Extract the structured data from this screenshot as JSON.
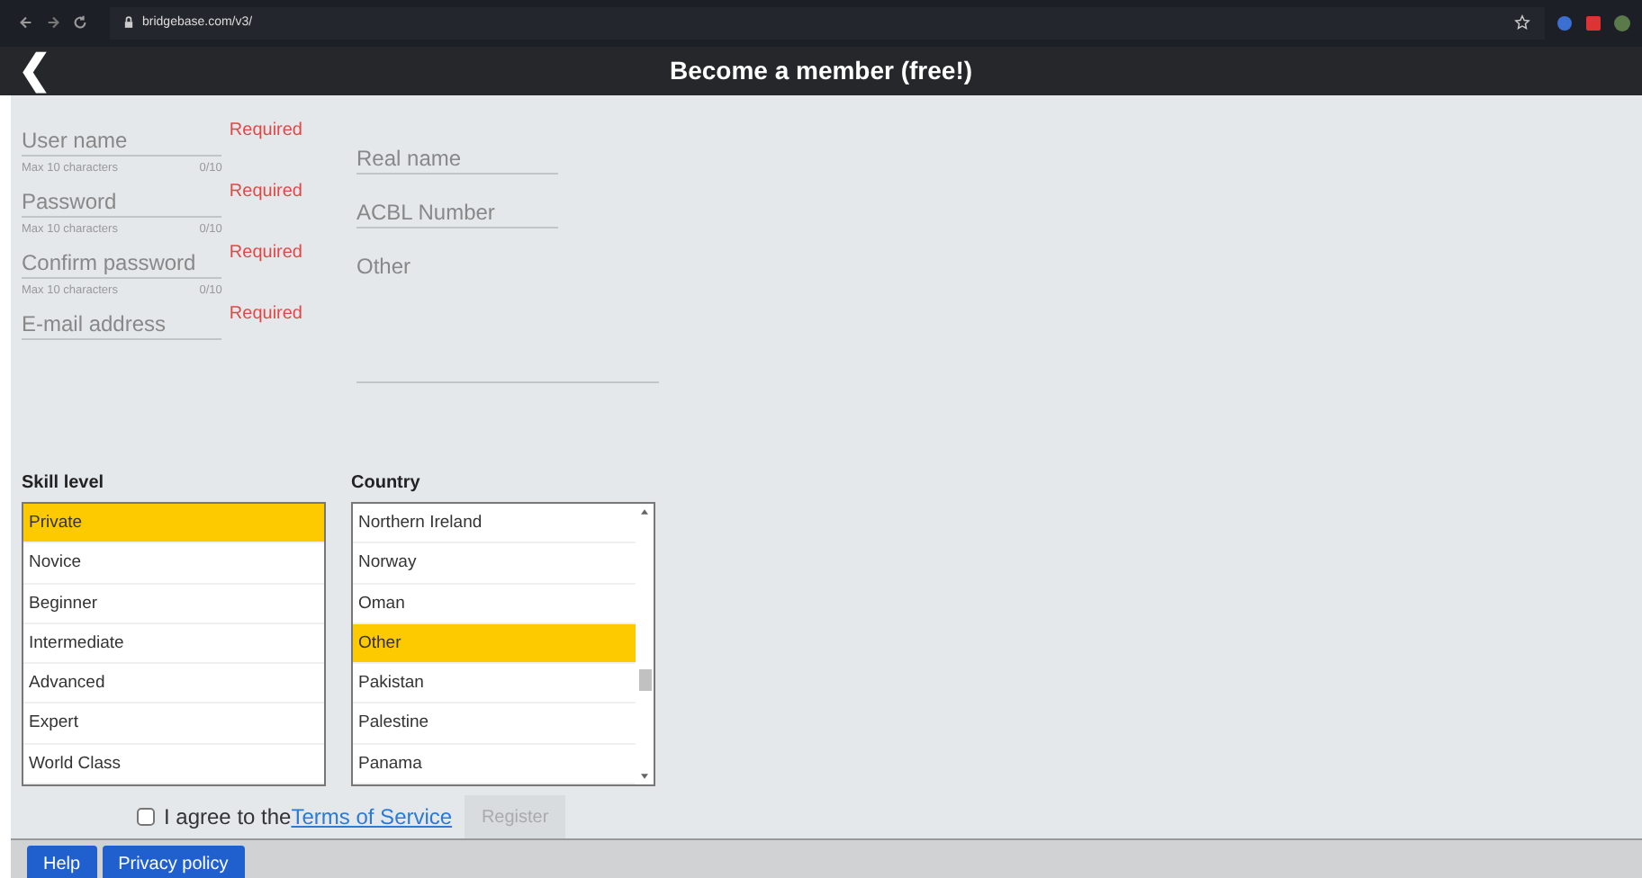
{
  "browser": {
    "url": "bridgebase.com/v3/"
  },
  "header": {
    "back": "❮",
    "title": "Become a member (free!)"
  },
  "account_fields": [
    {
      "placeholder": "User name",
      "required": "Required",
      "hint": "Max 10 characters",
      "counter": "0/10"
    },
    {
      "placeholder": "Password",
      "required": "Required",
      "hint": "Max 10 characters",
      "counter": "0/10"
    },
    {
      "placeholder": "Confirm password",
      "required": "Required",
      "hint": "Max 10 characters",
      "counter": "0/10"
    },
    {
      "placeholder": "E-mail address",
      "required": "Required"
    }
  ],
  "profile_fields": [
    {
      "placeholder": "Real name"
    },
    {
      "placeholder": "ACBL Number"
    }
  ],
  "other_field": {
    "placeholder": "Other"
  },
  "skill_level": {
    "label": "Skill level",
    "items": [
      {
        "label": "Private",
        "selected": true
      },
      {
        "label": "Novice",
        "selected": false
      },
      {
        "label": "Beginner",
        "selected": false
      },
      {
        "label": "Intermediate",
        "selected": false
      },
      {
        "label": "Advanced",
        "selected": false
      },
      {
        "label": "Expert",
        "selected": false
      },
      {
        "label": "World Class",
        "selected": false
      }
    ]
  },
  "country": {
    "label": "Country",
    "items": [
      {
        "label": "Northern Ireland",
        "selected": false
      },
      {
        "label": "Norway",
        "selected": false
      },
      {
        "label": "Oman",
        "selected": false
      },
      {
        "label": "Other",
        "selected": true
      },
      {
        "label": "Pakistan",
        "selected": false
      },
      {
        "label": "Palestine",
        "selected": false
      },
      {
        "label": "Panama",
        "selected": false
      }
    ]
  },
  "agree": {
    "checked": false,
    "text": "I agree to the",
    "link": "Terms of Service"
  },
  "register": {
    "label": "Register",
    "disabled": true
  },
  "footer_buttons": [
    "Help",
    "Privacy policy"
  ]
}
